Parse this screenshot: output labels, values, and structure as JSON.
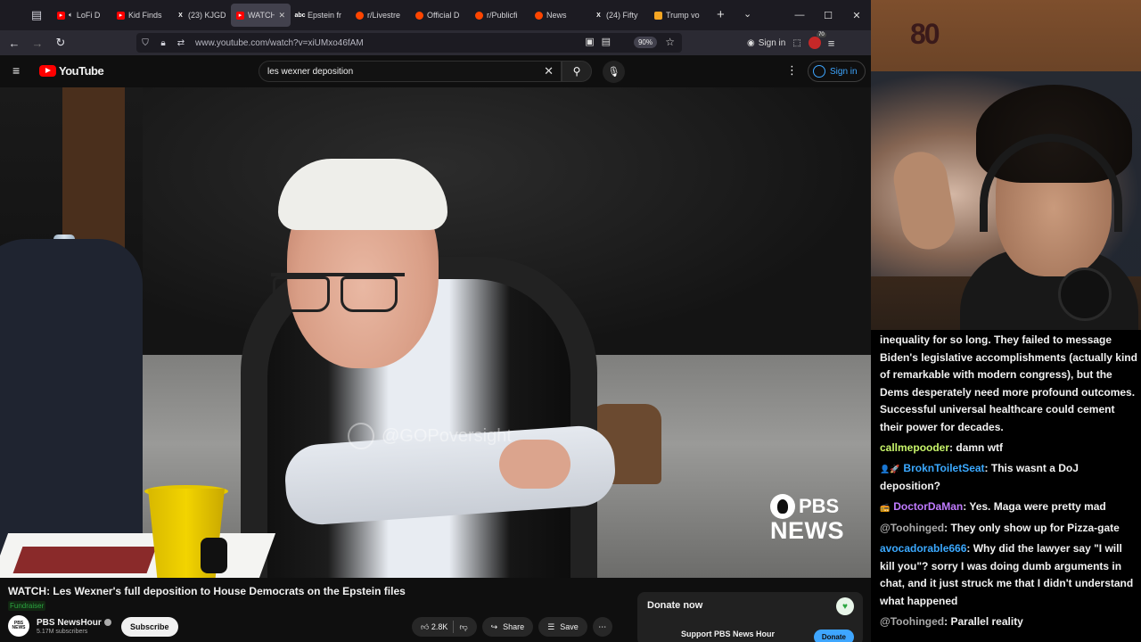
{
  "browser": {
    "tabs": [
      {
        "title": "LoFi D",
        "icon": "youtube-favicon",
        "color": "#ff0000",
        "active": false,
        "muted": true
      },
      {
        "title": "Kid Finds",
        "icon": "youtube-favicon",
        "color": "#ff0000",
        "active": false
      },
      {
        "title": "(23) KJGD",
        "icon": "x-favicon",
        "color": "#ffffff",
        "active": false
      },
      {
        "title": "WATCH",
        "icon": "youtube-favicon",
        "color": "#ff0000",
        "active": true
      },
      {
        "title": "Epstein fr",
        "icon": "abc-favicon",
        "color": "#ffffff",
        "active": false
      },
      {
        "title": "r/Livestre",
        "icon": "reddit-favicon",
        "color": "#ff4500",
        "active": false
      },
      {
        "title": "Official D",
        "icon": "reddit-favicon",
        "color": "#ff4500",
        "active": false
      },
      {
        "title": "r/Publicfi",
        "icon": "reddit-favicon",
        "color": "#ff4500",
        "active": false
      },
      {
        "title": "News",
        "icon": "reddit-favicon",
        "color": "#ff4500",
        "active": false
      },
      {
        "title": "(24) Fifty",
        "icon": "x-favicon",
        "color": "#ffffff",
        "active": false
      },
      {
        "title": "Trump vo",
        "icon": "nbc-favicon",
        "color": "#f5a623",
        "active": false
      }
    ],
    "url": "www.youtube.com/watch?v=xiUMxo46fAM",
    "zoom": "90%",
    "signin_label": "Sign in",
    "extension_badge": "70"
  },
  "youtube": {
    "logo_text": "YouTube",
    "search_value": "les wexner deposition",
    "signin_label": "Sign in",
    "watermark": "@GOPoversight",
    "pbs_top": "PBS",
    "pbs_bottom": "NEWS",
    "video_title": "WATCH: Les Wexner's full deposition to House Democrats on the Epstein files",
    "fundraiser_label": "Fundraiser",
    "channel_avatar_text": "PBS NEWS",
    "channel_name": "PBS NewsHour",
    "subscribers": "5.17M subscribers",
    "subscribe_label": "Subscribe",
    "likes": "2.8K",
    "share_label": "Share",
    "save_label": "Save",
    "donate_title": "Donate now",
    "support_text": "Support PBS News Hour",
    "donate_label": "Donate"
  },
  "stream": {
    "overlay_logo": "80",
    "chat": [
      {
        "user": "",
        "user_color": "#ffffff",
        "badge": "",
        "text": "inequality for so long. They failed to message Biden's legislative accomplishments (actually kind of remarkable with modern congress), but the Dems desperately need more profound outcomes. Successful universal healthcare could cement their power for decades."
      },
      {
        "user": "callmepooder",
        "user_color": "#c8f56b",
        "badge": "",
        "text": ": damn wtf"
      },
      {
        "user": "BroknToiletSeat",
        "user_color": "#3ba9ff",
        "badge": "👤🚀",
        "text": ": This wasnt a DoJ deposition?"
      },
      {
        "user": "DoctorDaMan",
        "user_color": "#c07bff",
        "badge": "📻",
        "text": ": Yes. Maga were pretty mad"
      },
      {
        "user": "@Toohinged",
        "user_color": "#aaaaaa",
        "badge": "",
        "text": ": They only show up for Pizza-gate"
      },
      {
        "user": "avocadorable666",
        "user_color": "#3ba9ff",
        "badge": "",
        "text": ": Why did the lawyer say \"I will kill you\"? sorry I was doing dumb arguments in chat, and it just struck me that I didn't understand what happened"
      },
      {
        "user": "@Toohinged",
        "user_color": "#aaaaaa",
        "badge": "",
        "text": ": Parallel reality"
      }
    ]
  }
}
